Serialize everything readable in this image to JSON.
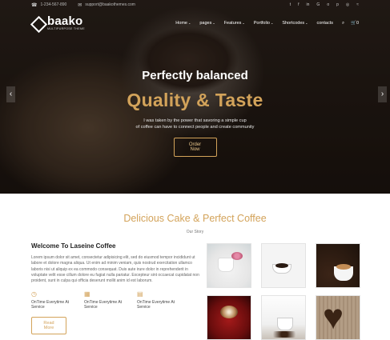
{
  "topbar": {
    "phone": "1-234-567-890",
    "email": "support@baakothemes.com",
    "socials": [
      "twitter-icon",
      "facebook-icon",
      "linkedin-icon",
      "google-plus-icon",
      "github-icon",
      "pinterest-icon",
      "instagram-icon",
      "rss-icon"
    ],
    "social_glyphs": [
      "t",
      "f",
      "in",
      "G",
      "o",
      "p",
      "◎",
      "≈"
    ]
  },
  "logo": {
    "name": "baako",
    "tagline": "MULTIPURPOSE THEME"
  },
  "nav": {
    "items": [
      {
        "label": "Home",
        "chevron": true
      },
      {
        "label": "pages",
        "chevron": true
      },
      {
        "label": "Features",
        "chevron": true
      },
      {
        "label": "Portfolio",
        "chevron": true
      },
      {
        "label": "Shortcodes",
        "chevron": true
      },
      {
        "label": "contacts",
        "chevron": false
      }
    ],
    "cart_count": "0"
  },
  "hero": {
    "subtitle": "Perfectly balanced",
    "title": "Quality & Taste",
    "desc_line1": "I was taken by the power that savoring a simple cup",
    "desc_line2": "of coffee can have to connect people and create community",
    "button": "Order Now"
  },
  "about": {
    "title": "Delicious Cake & Perfect Coffee",
    "subtitle": "Our Story",
    "welcome": "Welcome To Laseine Coffee",
    "text": "Lorem ipsum dolor sit amet, consectetur adipisicing elit, sed do eiusmod tempor incididunt ut labore et dolore magna aliqua. Ut enim ad minim veniam, quis nostrud exercitation ullamco laboris nisi ut aliquip ex ea commodo consequat. Duis aute irure dolor in reprehenderit in voluptate velit esse cillum dolore eu fugiat nulla pariatur. Excepteur sint occaecat cupidatat non proident, sunt in culpa qui officia deserunt mollit anim id est laborum.",
    "features": [
      {
        "icon": "clock-icon",
        "line1": "OnTime Everytime At",
        "line2": "Service"
      },
      {
        "icon": "calendar-icon",
        "line1": "OnTime Everytime At",
        "line2": "Service"
      },
      {
        "icon": "grid-icon",
        "line1": "OnTime Everytime At",
        "line2": "Service"
      }
    ],
    "button": "Read More"
  },
  "gallery": [
    "gallery-mug-flowers",
    "gallery-espresso-cup",
    "gallery-latte-beans",
    "gallery-cappuccino-red",
    "gallery-steaming-cup",
    "gallery-bean-heart"
  ]
}
